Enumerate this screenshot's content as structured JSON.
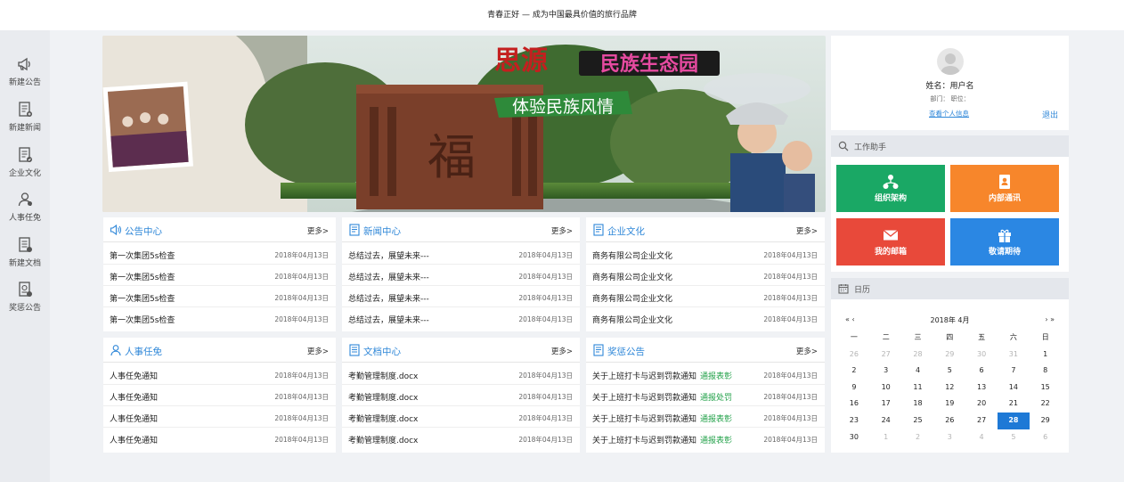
{
  "header": {
    "slogan": "青春正好 — 成为中国最具价值的旅行品牌"
  },
  "sidebar": {
    "items": [
      {
        "label": "新建公告",
        "icon": "megaphone-icon"
      },
      {
        "label": "新建新闻",
        "icon": "news-doc-icon"
      },
      {
        "label": "企业文化",
        "icon": "culture-doc-icon"
      },
      {
        "label": "人事任免",
        "icon": "person-icon"
      },
      {
        "label": "新建文档",
        "icon": "document-icon"
      },
      {
        "label": "奖惩公告",
        "icon": "award-doc-icon"
      }
    ]
  },
  "banner": {
    "title_brand": "思源",
    "title_park": "民族生态园",
    "subtitle": "体验民族风情",
    "gate_char": "福"
  },
  "panels": [
    {
      "title": "公告中心",
      "more": "更多>",
      "icon": "megaphone-icon",
      "rows": [
        {
          "text": "第一次集团5s检查",
          "date": "2018年04月13日"
        },
        {
          "text": "第一次集团5s检查",
          "date": "2018年04月13日"
        },
        {
          "text": "第一次集团5s检查",
          "date": "2018年04月13日"
        },
        {
          "text": "第一次集团5s检查",
          "date": "2018年04月13日"
        }
      ]
    },
    {
      "title": "新闻中心",
      "more": "更多>",
      "icon": "news-doc-icon",
      "rows": [
        {
          "text": "总结过去，展望未来---",
          "date": "2018年04月13日"
        },
        {
          "text": "总结过去，展望未来---",
          "date": "2018年04月13日"
        },
        {
          "text": "总结过去，展望未来---",
          "date": "2018年04月13日"
        },
        {
          "text": "总结过去，展望未来---",
          "date": "2018年04月13日"
        }
      ]
    },
    {
      "title": "企业文化",
      "more": "更多>",
      "icon": "culture-doc-icon",
      "rows": [
        {
          "text": "商务有限公司企业文化",
          "date": "2018年04月13日"
        },
        {
          "text": "商务有限公司企业文化",
          "date": "2018年04月13日"
        },
        {
          "text": "商务有限公司企业文化",
          "date": "2018年04月13日"
        },
        {
          "text": "商务有限公司企业文化",
          "date": "2018年04月13日"
        }
      ]
    },
    {
      "title": "人事任免",
      "more": "更多>",
      "icon": "person-icon",
      "rows": [
        {
          "text": "人事任免通知",
          "date": "2018年04月13日"
        },
        {
          "text": "人事任免通知",
          "date": "2018年04月13日"
        },
        {
          "text": "人事任免通知",
          "date": "2018年04月13日"
        },
        {
          "text": "人事任免通知",
          "date": "2018年04月13日"
        }
      ]
    },
    {
      "title": "文档中心",
      "more": "更多>",
      "icon": "document-icon",
      "rows": [
        {
          "text": "考勤管理制度.docx",
          "date": "2018年04月13日"
        },
        {
          "text": "考勤管理制度.docx",
          "date": "2018年04月13日"
        },
        {
          "text": "考勤管理制度.docx",
          "date": "2018年04月13日"
        },
        {
          "text": "考勤管理制度.docx",
          "date": "2018年04月13日"
        }
      ]
    },
    {
      "title": "奖惩公告",
      "more": "更多>",
      "icon": "award-doc-icon",
      "rows": [
        {
          "text": "关于上班打卡与迟到罚款通知",
          "tag": "通报表彰",
          "date": "2018年04月13日"
        },
        {
          "text": "关于上班打卡与迟到罚款通知",
          "tag": "通报处罚",
          "date": "2018年04月13日"
        },
        {
          "text": "关于上班打卡与迟到罚款通知",
          "tag": "通报表彰",
          "date": "2018年04月13日"
        },
        {
          "text": "关于上班打卡与迟到罚款通知",
          "tag": "通报表彰",
          "date": "2018年04月13日"
        }
      ]
    }
  ],
  "user": {
    "name": "姓名：用户名",
    "dept": "部门：  职位：",
    "view_link": "查看个人信息",
    "logout": "退出"
  },
  "work_helper": {
    "title": "工作助手",
    "tiles": [
      {
        "label": "组织架构",
        "icon": "org-chart-icon",
        "color": "#1aa865"
      },
      {
        "label": "内部通讯",
        "icon": "address-book-icon",
        "color": "#f7862b"
      },
      {
        "label": "我的邮箱",
        "icon": "mail-icon",
        "color": "#e8493a"
      },
      {
        "label": "敬请期待",
        "icon": "gift-icon",
        "color": "#2b87e3"
      }
    ]
  },
  "calendar": {
    "title": "日历",
    "month_label": "2018年  4月",
    "nav_prev": "« ‹",
    "nav_next": "› »",
    "weekdays": [
      "一",
      "二",
      "三",
      "四",
      "五",
      "六",
      "日"
    ],
    "weeks": [
      [
        "26",
        "27",
        "28",
        "29",
        "30",
        "31",
        "1"
      ],
      [
        "2",
        "3",
        "4",
        "5",
        "6",
        "7",
        "8"
      ],
      [
        "9",
        "10",
        "11",
        "12",
        "13",
        "14",
        "15"
      ],
      [
        "16",
        "17",
        "18",
        "19",
        "20",
        "21",
        "22"
      ],
      [
        "23",
        "24",
        "25",
        "26",
        "27",
        "28",
        "29"
      ],
      [
        "30",
        "1",
        "2",
        "3",
        "4",
        "5",
        "6"
      ]
    ],
    "today": "28"
  },
  "colors": {
    "accent": "#2f87d8",
    "praise": "#22a149",
    "today_bg": "#1e79d6"
  }
}
